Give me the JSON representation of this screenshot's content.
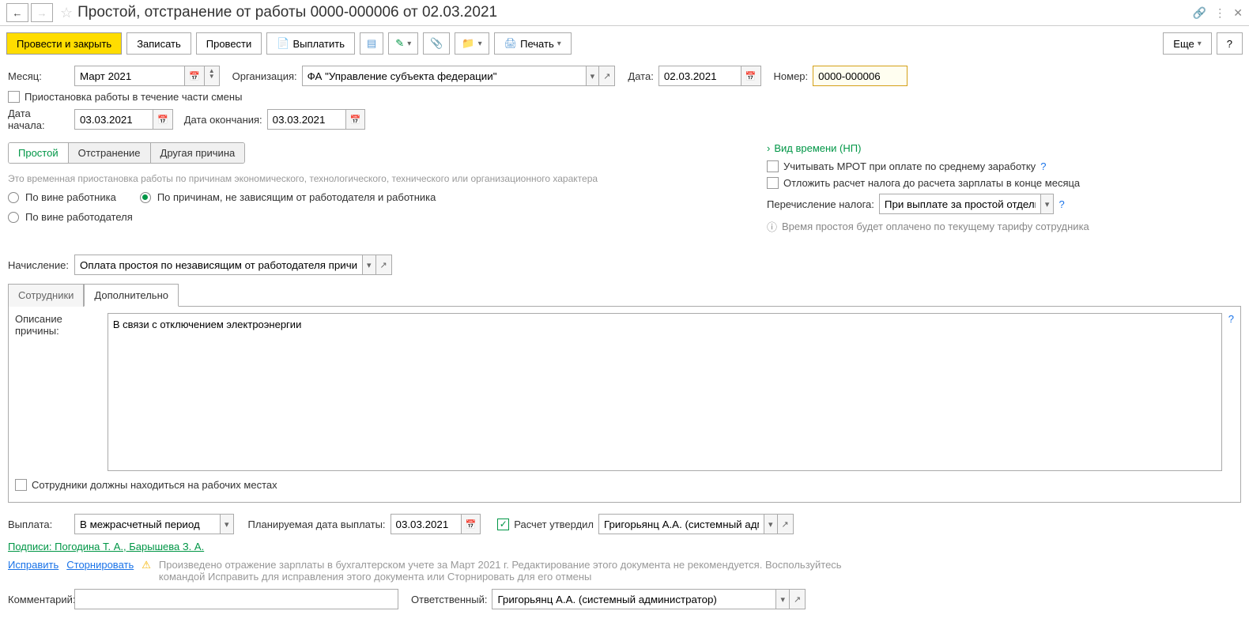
{
  "header": {
    "title": "Простой, отстранение от работы 0000-000006 от 02.03.2021"
  },
  "toolbar": {
    "post_close": "Провести и закрыть",
    "save": "Записать",
    "post": "Провести",
    "pay": "Выплатить",
    "print": "Печать",
    "more": "Еще"
  },
  "fields": {
    "month_label": "Месяц:",
    "month_value": "Март 2021",
    "org_label": "Организация:",
    "org_value": "ФА \"Управление субъекта федерации\"",
    "date_label": "Дата:",
    "date_value": "02.03.2021",
    "number_label": "Номер:",
    "number_value": "0000-000006",
    "partial_shift": "Приостановка работы в течение части смены",
    "start_label": "Дата начала:",
    "start_value": "03.03.2021",
    "end_label": "Дата окончания:",
    "end_value": "03.03.2021"
  },
  "tabs": {
    "t1": "Простой",
    "t2": "Отстранение",
    "t3": "Другая причина"
  },
  "left": {
    "hint": "Это временная приостановка работы по причинам экономического, технологического, технического или организационного характера",
    "r1": "По вине работника",
    "r2": "По причинам, не зависящим от работодателя и работника",
    "r3": "По вине работодателя"
  },
  "right": {
    "time_type": "Вид времени (НП)",
    "mrot": "Учитывать МРОТ при оплате по среднему заработку",
    "defer_tax": "Отложить расчет налога до расчета зарплаты в конце месяца",
    "tax_transfer_label": "Перечисление налога:",
    "tax_transfer_value": "При выплате за простой отдельно",
    "info_text": "Время простоя будет оплачено по текущему тарифу сотрудника"
  },
  "accrual": {
    "label": "Начисление:",
    "value": "Оплата простоя по независящим от работодателя причинам"
  },
  "subtabs": {
    "employees": "Сотрудники",
    "additional": "Дополнительно"
  },
  "additional": {
    "desc_label": "Описание причины:",
    "desc_value": "В связи с отключением электроэнергии",
    "at_workplace": "Сотрудники должны находиться на рабочих местах"
  },
  "payment": {
    "label": "Выплата:",
    "value": "В межрасчетный период",
    "planned_label": "Планируемая дата выплаты:",
    "planned_value": "03.03.2021",
    "approved_label": "Расчет утвердил",
    "approved_value": "Григорьянц А.А. (системный адми"
  },
  "signatures": "Подписи: Погодина Т. А., Барышева З. А.",
  "correct": "Исправить",
  "reverse": "Сторнировать",
  "warning": "Произведено отражение зарплаты в бухгалтерском учете за Март 2021 г. Редактирование этого документа не рекомендуется. Воспользуйтесь командой Исправить для исправления этого документа или Сторнировать для его отмены",
  "comment": {
    "label": "Комментарий:",
    "resp_label": "Ответственный:",
    "resp_value": "Григорьянц А.А. (системный администратор)"
  }
}
